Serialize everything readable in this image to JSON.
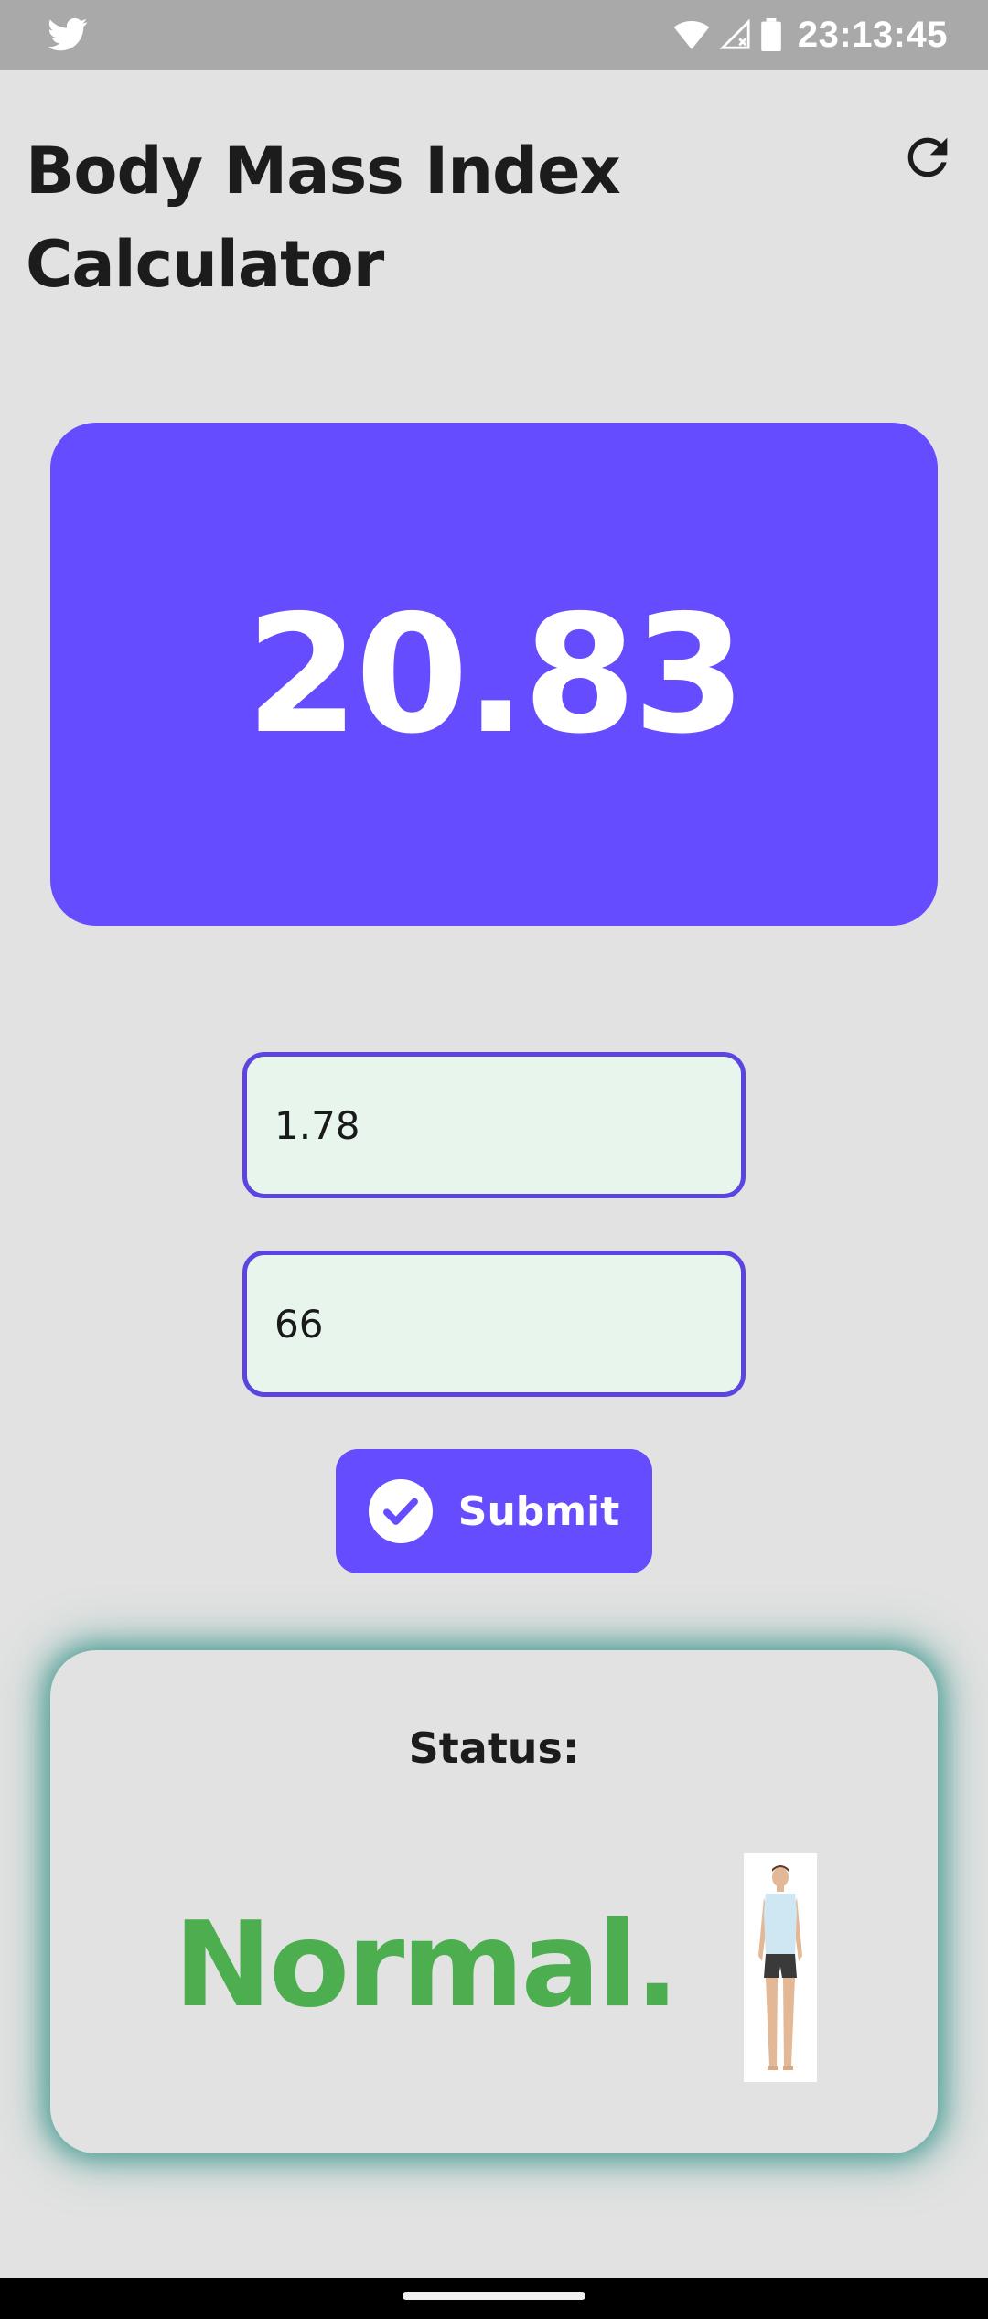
{
  "status_bar": {
    "time": "23:13:45",
    "icons": [
      "twitter-icon",
      "wifi-icon",
      "no-signal-icon",
      "battery-icon"
    ]
  },
  "header": {
    "title": "Body Mass Index Calculator",
    "refresh_icon": "refresh-icon"
  },
  "result": {
    "bmi_value": "20.83",
    "card_color": "#654cff"
  },
  "form": {
    "height_value": "1.78",
    "weight_value": "66",
    "field_border_color": "#5b45e0",
    "field_background": "#e7f5ec",
    "submit_label": "Submit",
    "submit_icon": "check-circle-icon"
  },
  "status": {
    "label": "Status:",
    "value": "Normal.",
    "value_color": "#4cae4f",
    "figure": "body-figure-image"
  }
}
